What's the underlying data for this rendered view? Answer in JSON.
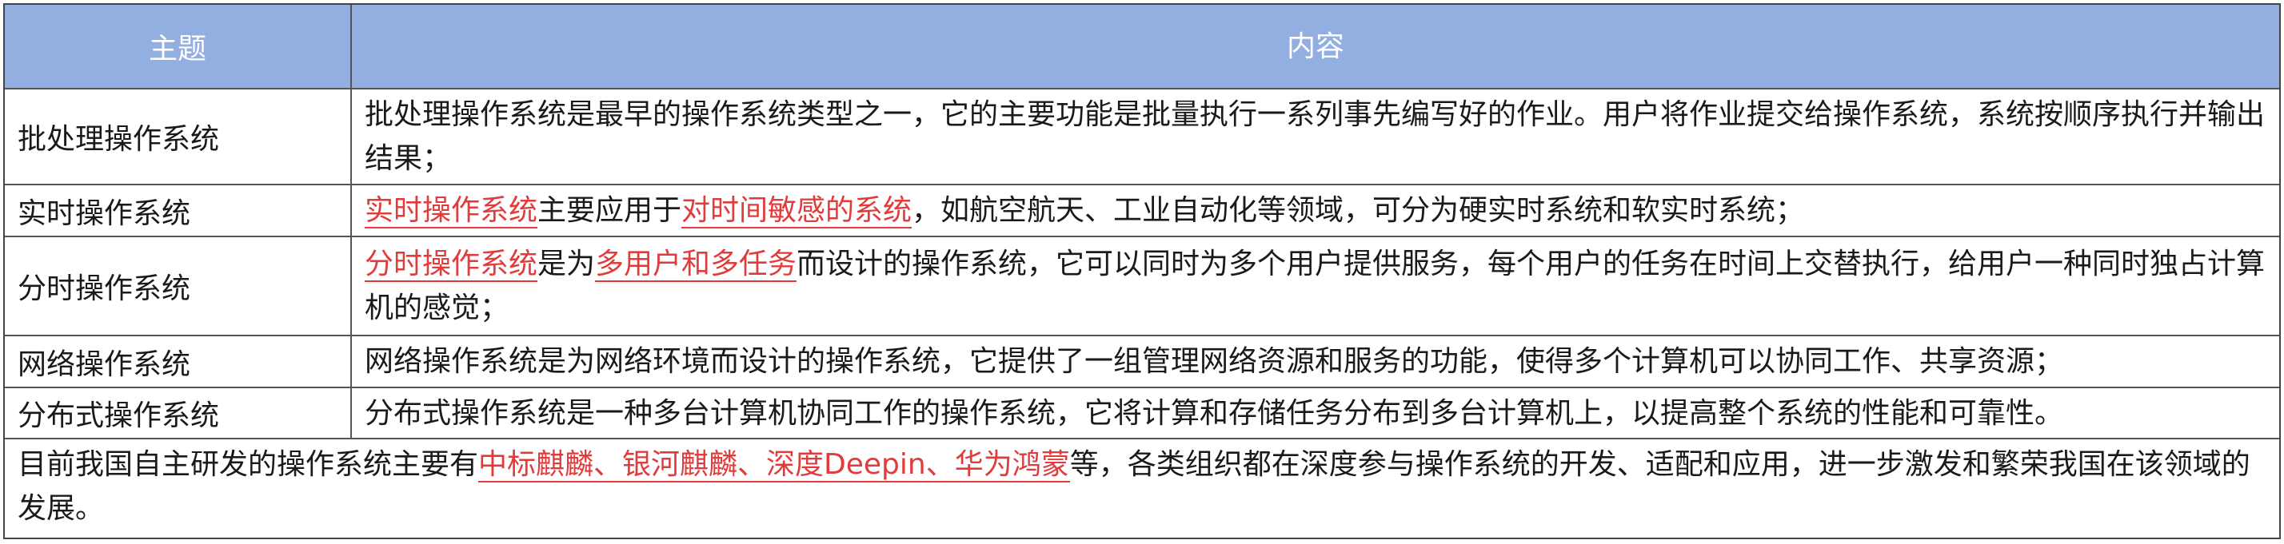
{
  "header": {
    "topic": "主题",
    "content": "内容"
  },
  "rows": [
    {
      "topic": "批处理操作系统",
      "parts": [
        {
          "t": "批处理操作系统是最早的操作系统类型之一，它的主要功能是批量执行一系列事先编写好的作业。用户将作业提交给操作系统，系统按顺序执行并输出结果；"
        }
      ]
    },
    {
      "topic": "实时操作系统",
      "parts": [
        {
          "t": "实时操作系统",
          "hl": true
        },
        {
          "t": "主要应用于"
        },
        {
          "t": "对时间敏感的系统",
          "hl": true
        },
        {
          "t": "，如航空航天、工业自动化等领域，可分为硬实时系统和软实时系统；"
        }
      ]
    },
    {
      "topic": "分时操作系统",
      "parts": [
        {
          "t": "分时操作系统",
          "hl": true
        },
        {
          "t": "是为"
        },
        {
          "t": "多用户和多任务",
          "hl": true
        },
        {
          "t": "而设计的操作系统，它可以同时为多个用户提供服务，每个用户的任务在时间上交替执行，给用户一种同时独占计算机的感觉；"
        }
      ]
    },
    {
      "topic": "网络操作系统",
      "parts": [
        {
          "t": "网络操作系统是为网络环境而设计的操作系统，它提供了一组管理网络资源和服务的功能，使得多个计算机可以协同工作、共享资源；"
        }
      ]
    },
    {
      "topic": "分布式操作系统",
      "parts": [
        {
          "t": "分布式操作系统是一种多台计算机协同工作的操作系统，它将计算和存储任务分布到多台计算机上，以提高整个系统的性能和可靠性。"
        }
      ]
    }
  ],
  "footer": {
    "parts": [
      {
        "t": "目前我国自主研发的操作系统主要有"
      },
      {
        "t": "中标麒麟、银河麒麟、深度Deepin、华为鸿蒙",
        "hl": true
      },
      {
        "t": "等，各类组织都在深度参与操作系统的开发、适配和应用，进一步激发和繁荣我国在该领域的发展。"
      }
    ]
  }
}
